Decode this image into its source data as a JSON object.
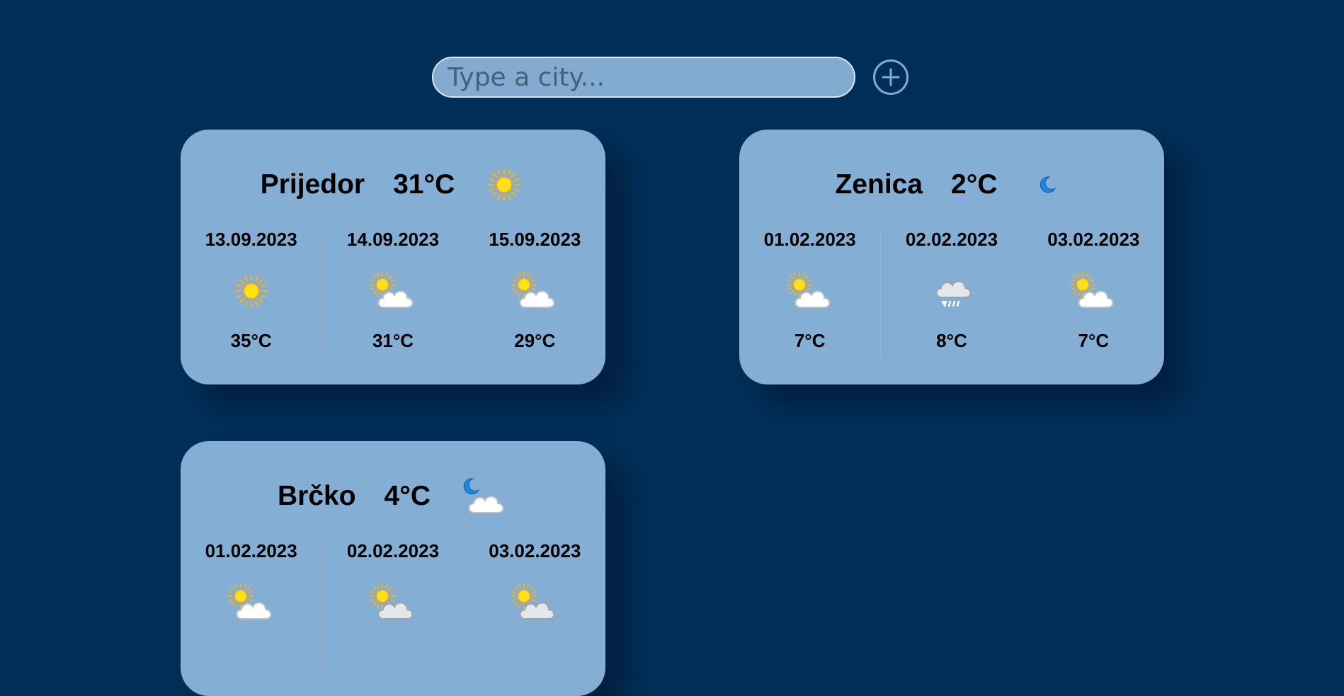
{
  "search": {
    "placeholder": "Type a city..."
  },
  "cards": [
    {
      "city": "Prijedor",
      "temp": "31°C",
      "icon": "sun-icon",
      "forecast": [
        {
          "date": "13.09.2023",
          "icon": "sun-icon",
          "temp": "35°C"
        },
        {
          "date": "14.09.2023",
          "icon": "partly-cloudy-icon",
          "temp": "31°C"
        },
        {
          "date": "15.09.2023",
          "icon": "partly-cloudy-icon",
          "temp": "29°C"
        }
      ]
    },
    {
      "city": "Zenica",
      "temp": "2°C",
      "icon": "moon-icon",
      "forecast": [
        {
          "date": "01.02.2023",
          "icon": "partly-cloudy-icon",
          "temp": "7°C"
        },
        {
          "date": "02.02.2023",
          "icon": "rain-cloud-icon",
          "temp": "8°C"
        },
        {
          "date": "03.02.2023",
          "icon": "partly-cloudy-icon",
          "temp": "7°C"
        }
      ]
    },
    {
      "city": "Brčko",
      "temp": "4°C",
      "icon": "night-cloudy-icon",
      "forecast": [
        {
          "date": "01.02.2023",
          "icon": "partly-cloudy-icon",
          "temp": ""
        },
        {
          "date": "02.02.2023",
          "icon": "partly-cloudy-gray-icon",
          "temp": ""
        },
        {
          "date": "03.02.2023",
          "icon": "partly-cloudy-gray-icon",
          "temp": ""
        }
      ]
    }
  ],
  "colors": {
    "background": "#022f59",
    "card": "#84aed3",
    "accent": "#83abd0"
  }
}
